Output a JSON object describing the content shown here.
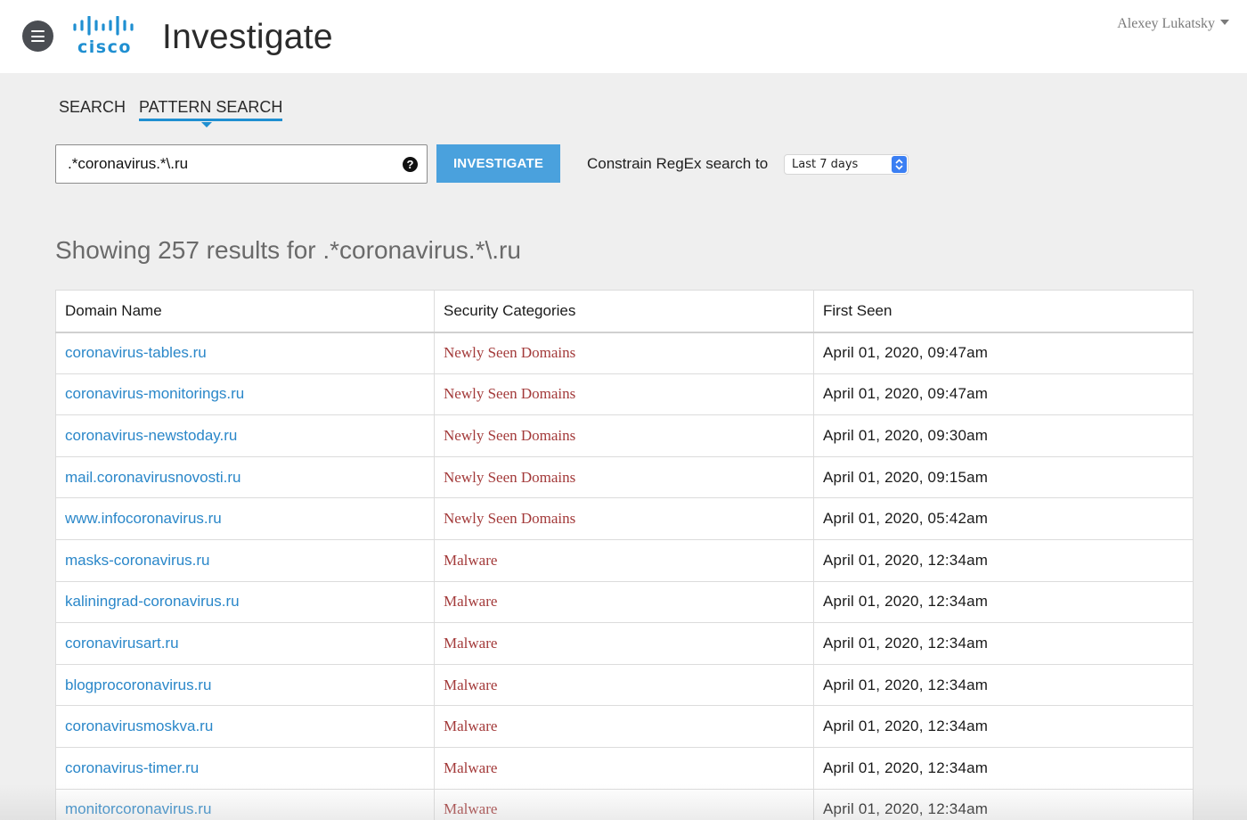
{
  "header": {
    "logo_text": "cisco",
    "app_title": "Investigate",
    "user_name": "Alexey Lukatsky"
  },
  "tabs": [
    {
      "label": "SEARCH",
      "active": false
    },
    {
      "label": "PATTERN SEARCH",
      "active": true
    }
  ],
  "search": {
    "value": ".*coronavirus.*\\.ru",
    "help_symbol": "?",
    "button_label": "INVESTIGATE"
  },
  "constrain": {
    "label": "Constrain RegEx search to",
    "selected": "Last 7 days"
  },
  "results": {
    "heading": "Showing 257 results for .*coronavirus.*\\.ru",
    "columns": [
      "Domain Name",
      "Security Categories",
      "First Seen"
    ],
    "rows": [
      {
        "domain": "coronavirus-tables.ru",
        "category": "Newly Seen Domains",
        "first_seen": "April 01, 2020, 09:47am"
      },
      {
        "domain": "coronavirus-monitorings.ru",
        "category": "Newly Seen Domains",
        "first_seen": "April 01, 2020, 09:47am"
      },
      {
        "domain": "coronavirus-newstoday.ru",
        "category": "Newly Seen Domains",
        "first_seen": "April 01, 2020, 09:30am"
      },
      {
        "domain": "mail.coronavirusnovosti.ru",
        "category": "Newly Seen Domains",
        "first_seen": "April 01, 2020, 09:15am"
      },
      {
        "domain": "www.infocoronavirus.ru",
        "category": "Newly Seen Domains",
        "first_seen": "April 01, 2020, 05:42am"
      },
      {
        "domain": "masks-coronavirus.ru",
        "category": "Malware",
        "first_seen": "April 01, 2020, 12:34am"
      },
      {
        "domain": "kaliningrad-coronavirus.ru",
        "category": "Malware",
        "first_seen": "April 01, 2020, 12:34am"
      },
      {
        "domain": "coronavirusart.ru",
        "category": "Malware",
        "first_seen": "April 01, 2020, 12:34am"
      },
      {
        "domain": "blogprocoronavirus.ru",
        "category": "Malware",
        "first_seen": "April 01, 2020, 12:34am"
      },
      {
        "domain": "coronavirusmoskva.ru",
        "category": "Malware",
        "first_seen": "April 01, 2020, 12:34am"
      },
      {
        "domain": "coronavirus-timer.ru",
        "category": "Malware",
        "first_seen": "April 01, 2020, 12:34am"
      },
      {
        "domain": "monitorcoronavirus.ru",
        "category": "Malware",
        "first_seen": "April 01, 2020, 12:34am"
      }
    ]
  },
  "colors": {
    "accent": "#1f8fd1",
    "button": "#4aa1dd",
    "link": "#2a87c9",
    "category": "#a33a3a"
  }
}
